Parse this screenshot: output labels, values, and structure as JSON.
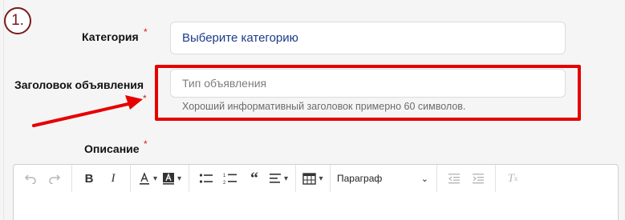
{
  "step_badge": "1.",
  "fields": {
    "category": {
      "label": "Категория",
      "required_mark": "*",
      "value": "Выберите категорию"
    },
    "title": {
      "label": "Заголовок объявления",
      "required_mark": "*",
      "placeholder": "Тип объявления",
      "hint": "Хороший информативный заголовок примерно 60 символов."
    },
    "description": {
      "label": "Описание",
      "required_mark": "*"
    }
  },
  "toolbar": {
    "paragraph_select": "Параграф",
    "icons": [
      "undo-icon",
      "redo-icon",
      "bold-icon",
      "italic-icon",
      "font-color-icon",
      "background-color-icon",
      "bulleted-list-icon",
      "numbered-list-icon",
      "blockquote-icon",
      "align-icon",
      "table-icon",
      "outdent-icon",
      "indent-icon",
      "remove-format-icon"
    ]
  },
  "colors": {
    "required": "#d21f1f",
    "highlight": "#e60000",
    "badge": "#7a1a1a",
    "category_text": "#1e3a8a"
  }
}
